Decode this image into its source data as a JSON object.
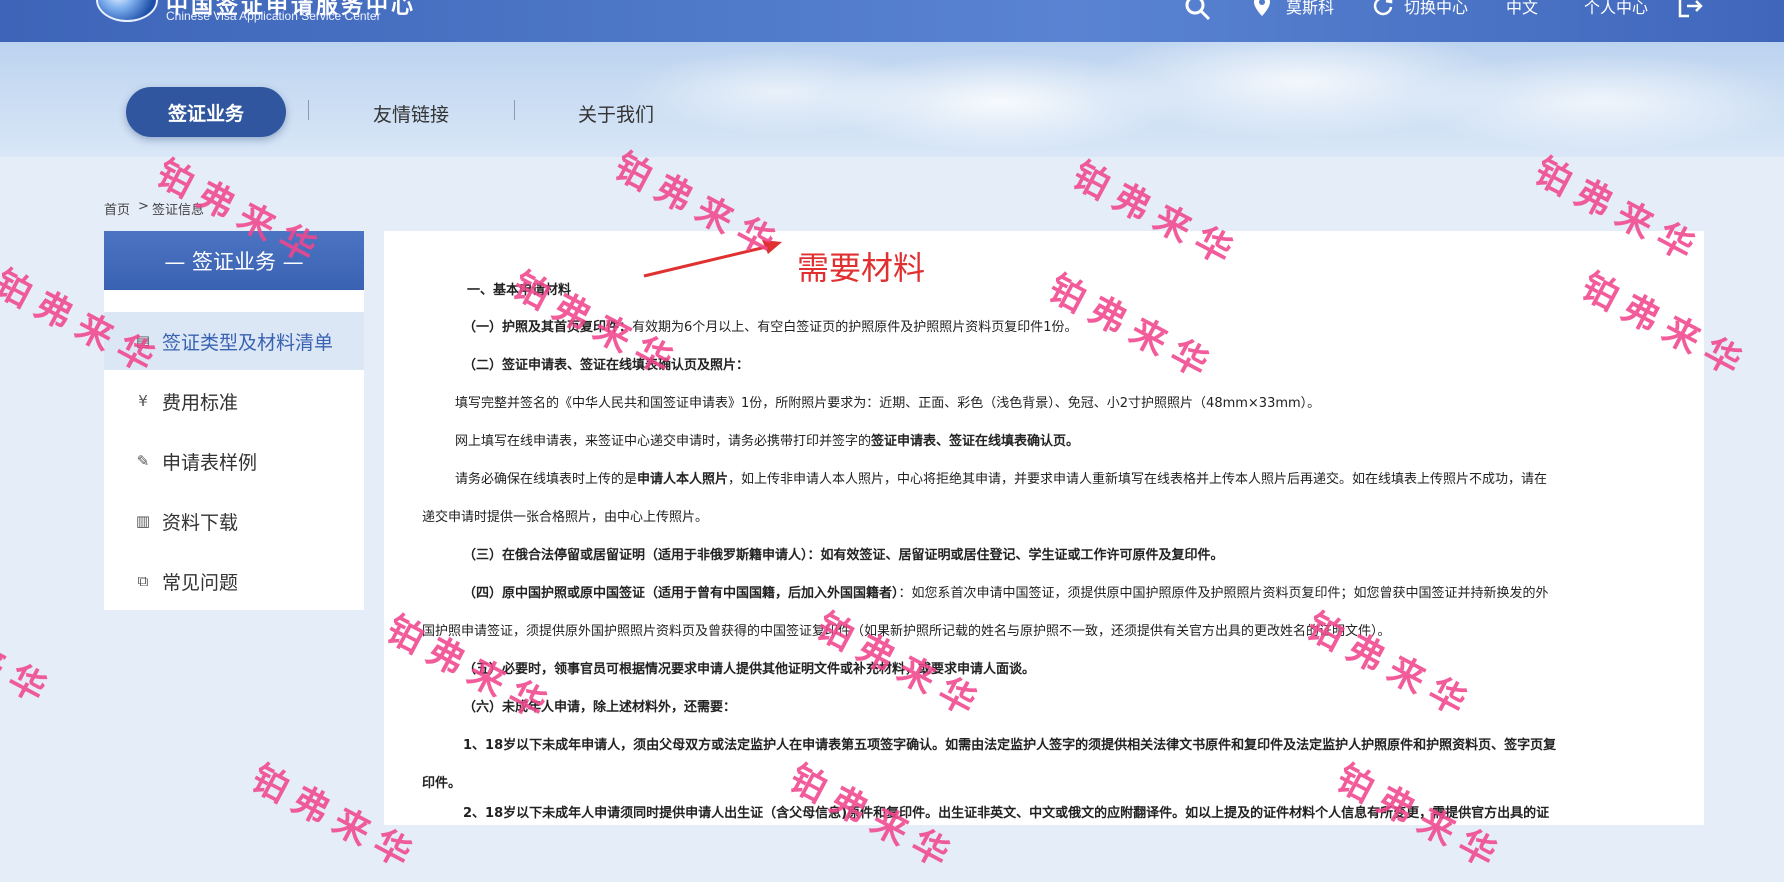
{
  "header": {
    "logo_cn": "中国签证申请服务中心",
    "logo_en": "Chinese Visa Application Service Center",
    "search_icon": "search-icon",
    "location_label": "莫斯科",
    "switch_center_label": "切换中心",
    "language_label": "中文",
    "user_center_label": "个人中心"
  },
  "nav": {
    "items": [
      {
        "label": "签证业务"
      },
      {
        "label": "友情链接"
      },
      {
        "label": "关于我们"
      }
    ]
  },
  "breadcrumb": {
    "home": "首页",
    "separator": ">",
    "current": "签证信息"
  },
  "sidebar": {
    "title": "— 签证业务 —",
    "items": [
      {
        "label": "签证类型及材料清单",
        "icon": "document-icon"
      },
      {
        "label": "费用标准",
        "icon": "yen-icon"
      },
      {
        "label": "申请表样例",
        "icon": "edit-icon"
      },
      {
        "label": "资料下载",
        "icon": "file-icon"
      },
      {
        "label": "常见问题",
        "icon": "question-icon"
      }
    ]
  },
  "annotation": {
    "text": "需要材料",
    "color": "#e03030"
  },
  "content": {
    "heading": "一、基本申请材料",
    "s1_bold": "（一）护照及其首页复印件：",
    "s1_text": "有效期为6个月以上、有空白签证页的护照原件及护照照片资料页复印件1份。",
    "s2_bold": "（二）签证申请表、签证在线填表确认页及照片：",
    "p1": "填写完整并签名的《中华人民共和国签证申请表》1份，所附照片要求为：近期、正面、彩色（浅色背景）、免冠、小2寸护照照片（48mm×33mm）。",
    "p2_a": "网上填写在线申请表，来签证中心递交申请时，请务必携带打印并签字的",
    "p2_b": "签证申请表、签证在线填表确认页。",
    "p3_a": "请务必确保在线填表时上传的是",
    "p3_b": "申请人本人照片",
    "p3_c": "，如上传非申请人本人照片，中心将拒绝其申请，并要求申请人重新填写在线表格并上传本人照片后再递交。如在线填表上传照片不成功，请在",
    "p3_d": "递交申请时提供一张合格照片，由中心上传照片。",
    "s3_bold": "（三）在俄合法停留或居留证明（适用于非俄罗斯籍申请人）：如有效签证、居留证明或居住登记、学生证或工作许可原件及复印件。",
    "s4_bold": "（四）原中国护照或原中国签证（适用于曾有中国国籍，后加入外国国籍者）",
    "s4_text": "：如您系首次申请中国签证，须提供原中国护照原件及护照照片资料页复印件；如您曾获中国签证并持新换发的外",
    "s4_text2": "国护照申请签证，须提供原外国护照照片资料页及曾获得的中国签证复印件（如果新护照所记载的姓名与原护照不一致，还须提供有关官方出具的更改姓名的证明文件）。",
    "s5_bold": "（五）必要时，领事官员可根据情况要求申请人提供其他证明文件或补充材料，或要求申请人面谈。",
    "s6_bold": "（六）未成年人申请，除上述材料外，还需要：",
    "m1": "1、18岁以下未成年申请人，须由父母双方或法定监护人在申请表第五项签字确认。如需由法定监护人签字的须提供相关法律文书原件和复印件及法定监护人护照原件和护照资料页、签字页复",
    "m1_cont": "印件。",
    "m2": "2、18岁以下未成年人申请须同时提供申请人出生证（含父母信息)原件和复印件。出生证非英文、中文或俄文的应附翻译件。如以上提及的证件材料个人信息有所变更，需提供官方出具的证"
  },
  "watermark": {
    "text": "铂弗来华",
    "color": "#f0468c"
  }
}
